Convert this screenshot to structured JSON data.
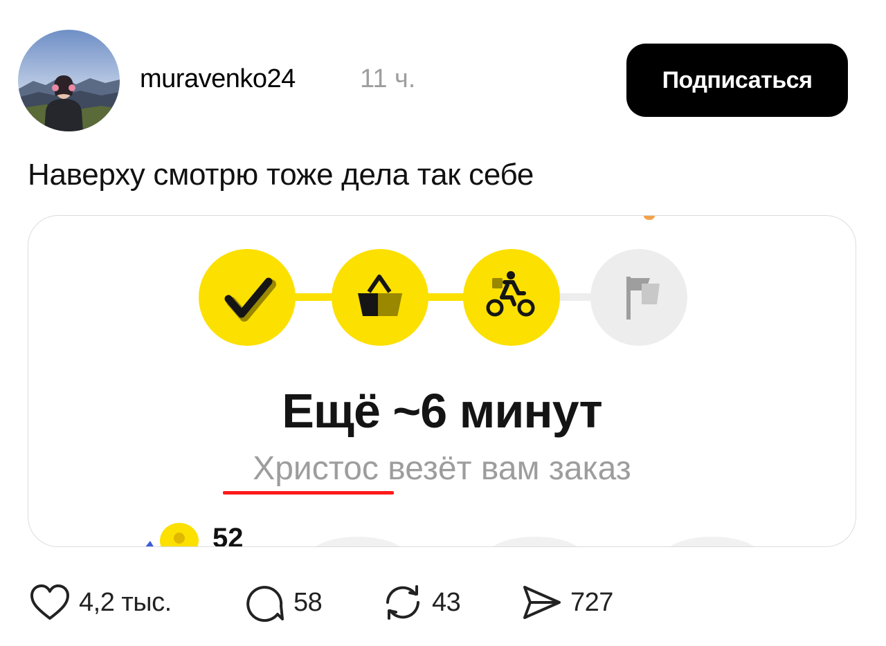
{
  "post": {
    "username": "muravenko24",
    "time_ago": "11 ч.",
    "follow_label": "Подписаться",
    "text": "Наверху смотрю тоже дела так себе"
  },
  "media": {
    "eta_title": "Ещё ~6 минут",
    "courier_name": "Христос",
    "status_rest": " везёт вам заказ",
    "coin_count": "52",
    "steps": [
      {
        "icon": "checkmark-icon",
        "state": "done"
      },
      {
        "icon": "basket-icon",
        "state": "done"
      },
      {
        "icon": "courier-bike-icon",
        "state": "active"
      },
      {
        "icon": "flag-icon",
        "state": "pending"
      }
    ],
    "colors": {
      "accent_yellow": "#fce000",
      "pending_gray": "#ededed",
      "highlight_red": "#ff1a1a"
    }
  },
  "actions": {
    "likes": "4,2 тыс.",
    "comments": "58",
    "reposts": "43",
    "shares": "727"
  }
}
